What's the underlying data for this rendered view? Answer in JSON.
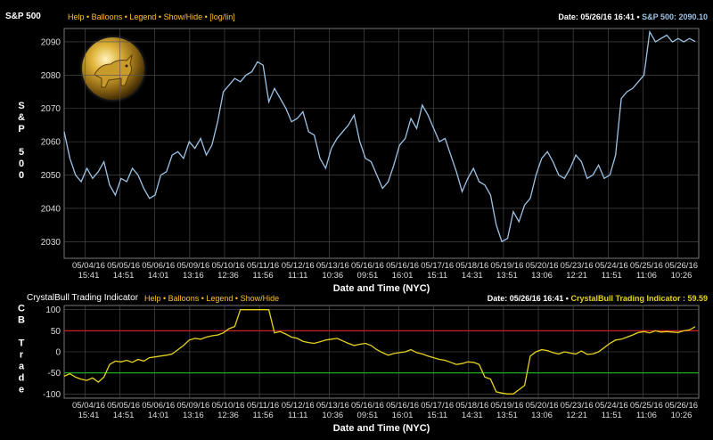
{
  "colors": {
    "background": "#000000",
    "menu": "#ffc12b",
    "sp500_line": "#9cc3e6",
    "indicator_line": "#e5d21f",
    "upper_threshold": "#cc1f1f",
    "lower_threshold": "#22a822",
    "grid": "#555555"
  },
  "top_panel": {
    "title": "S&P 500",
    "menu": [
      "Help",
      "Balloons",
      "Legend",
      "Show/Hide",
      "[log/lin]"
    ],
    "date_readout": "Date: 05/26/16 16:41",
    "value_readout": "S&P 500: 2090.10",
    "logo_icon": "golden-bull-icon"
  },
  "bottom_panel": {
    "title": "CrystalBull Trading Indicator",
    "menu": [
      "Help",
      "Balloons",
      "Legend",
      "Show/Hide"
    ],
    "date_readout": "Date: 05/26/16 16:41",
    "value_readout": "CrystalBull Trading Indicator : 59.59"
  },
  "chart_data": [
    {
      "type": "line",
      "ylabel": "S&P 500",
      "xlabel": "Date and Time (NYC)",
      "ylim": [
        2025,
        2094
      ],
      "yticks": [
        2030,
        2040,
        2050,
        2060,
        2070,
        2080,
        2090
      ],
      "grid": true,
      "x_tick_dates": [
        "05/04/16",
        "05/05/16",
        "05/06/16",
        "05/09/16",
        "05/10/16",
        "05/11/16",
        "05/12/16",
        "05/13/16",
        "05/16/16",
        "05/16/16",
        "05/17/16",
        "05/18/16",
        "05/19/16",
        "05/20/16",
        "05/23/16",
        "05/24/16",
        "05/25/16",
        "05/26/16"
      ],
      "x_tick_times": [
        "15:41",
        "14:51",
        "14:01",
        "13:16",
        "12:36",
        "11:56",
        "11:11",
        "10:36",
        "09:51",
        "16:01",
        "15:11",
        "14:31",
        "13:51",
        "13:06",
        "12:21",
        "11:51",
        "11:06",
        "10:26"
      ],
      "series": [
        {
          "values": [
            2063,
            2055,
            2050,
            2048,
            2052,
            2049,
            2051,
            2054,
            2047,
            2044,
            2049,
            2048,
            2052,
            2050,
            2046,
            2043,
            2044,
            2050,
            2051,
            2056,
            2057,
            2055,
            2060,
            2058,
            2061,
            2056,
            2059,
            2066,
            2075,
            2077,
            2079,
            2078,
            2080,
            2081,
            2084,
            2083,
            2072,
            2076,
            2073,
            2070,
            2066,
            2067,
            2069,
            2063,
            2062,
            2055,
            2052,
            2058,
            2061,
            2063,
            2065,
            2068,
            2060,
            2055,
            2054,
            2050,
            2046,
            2048,
            2053,
            2059,
            2061,
            2067,
            2064,
            2071,
            2068,
            2064,
            2060,
            2061,
            2056,
            2051,
            2045,
            2049,
            2052,
            2048,
            2047,
            2044,
            2035,
            2030,
            2031,
            2039,
            2036,
            2041,
            2043,
            2050,
            2055,
            2057,
            2054,
            2050,
            2049,
            2052,
            2056,
            2054,
            2049,
            2050,
            2053,
            2049,
            2050,
            2056,
            2073,
            2075,
            2076,
            2078,
            2080,
            2093,
            2090,
            2091,
            2092,
            2090,
            2091,
            2090,
            2091,
            2090.1
          ]
        }
      ]
    },
    {
      "type": "line",
      "ylabel": "CB Trade",
      "xlabel": "Date and Time (NYC)",
      "ylim": [
        -110,
        110
      ],
      "yticks": [
        -100,
        -50,
        0,
        50,
        100
      ],
      "grid": true,
      "thresholds": [
        50,
        -50
      ],
      "x_tick_dates": [
        "05/04/16",
        "05/05/16",
        "05/06/16",
        "05/09/16",
        "05/10/16",
        "05/11/16",
        "05/12/16",
        "05/13/16",
        "05/16/16",
        "05/16/16",
        "05/17/16",
        "05/18/16",
        "05/19/16",
        "05/20/16",
        "05/23/16",
        "05/24/16",
        "05/25/16",
        "05/26/16"
      ],
      "x_tick_times": [
        "15:41",
        "14:51",
        "14:01",
        "13:16",
        "12:36",
        "11:56",
        "11:11",
        "10:36",
        "09:51",
        "16:01",
        "15:11",
        "14:31",
        "13:51",
        "13:06",
        "12:21",
        "11:51",
        "11:06",
        "10:26"
      ],
      "series": [
        {
          "values": [
            -58,
            -52,
            -60,
            -65,
            -68,
            -62,
            -72,
            -60,
            -30,
            -22,
            -24,
            -20,
            -25,
            -18,
            -22,
            -14,
            -12,
            -10,
            -8,
            -5,
            5,
            15,
            28,
            32,
            30,
            35,
            38,
            40,
            45,
            55,
            60,
            100,
            100,
            100,
            100,
            100,
            100,
            45,
            48,
            42,
            35,
            32,
            25,
            22,
            20,
            24,
            28,
            30,
            32,
            26,
            20,
            15,
            18,
            20,
            15,
            5,
            -2,
            -8,
            -4,
            -2,
            0,
            5,
            -2,
            -5,
            -10,
            -14,
            -18,
            -20,
            -25,
            -30,
            -28,
            -24,
            -25,
            -30,
            -60,
            -65,
            -95,
            -98,
            -100,
            -100,
            -90,
            -80,
            -10,
            0,
            5,
            3,
            -2,
            -5,
            0,
            -3,
            -5,
            2,
            -6,
            -5,
            0,
            10,
            20,
            28,
            30,
            35,
            40,
            46,
            48,
            45,
            50,
            47,
            48,
            47,
            46,
            50,
            52,
            59.59
          ]
        }
      ]
    }
  ]
}
